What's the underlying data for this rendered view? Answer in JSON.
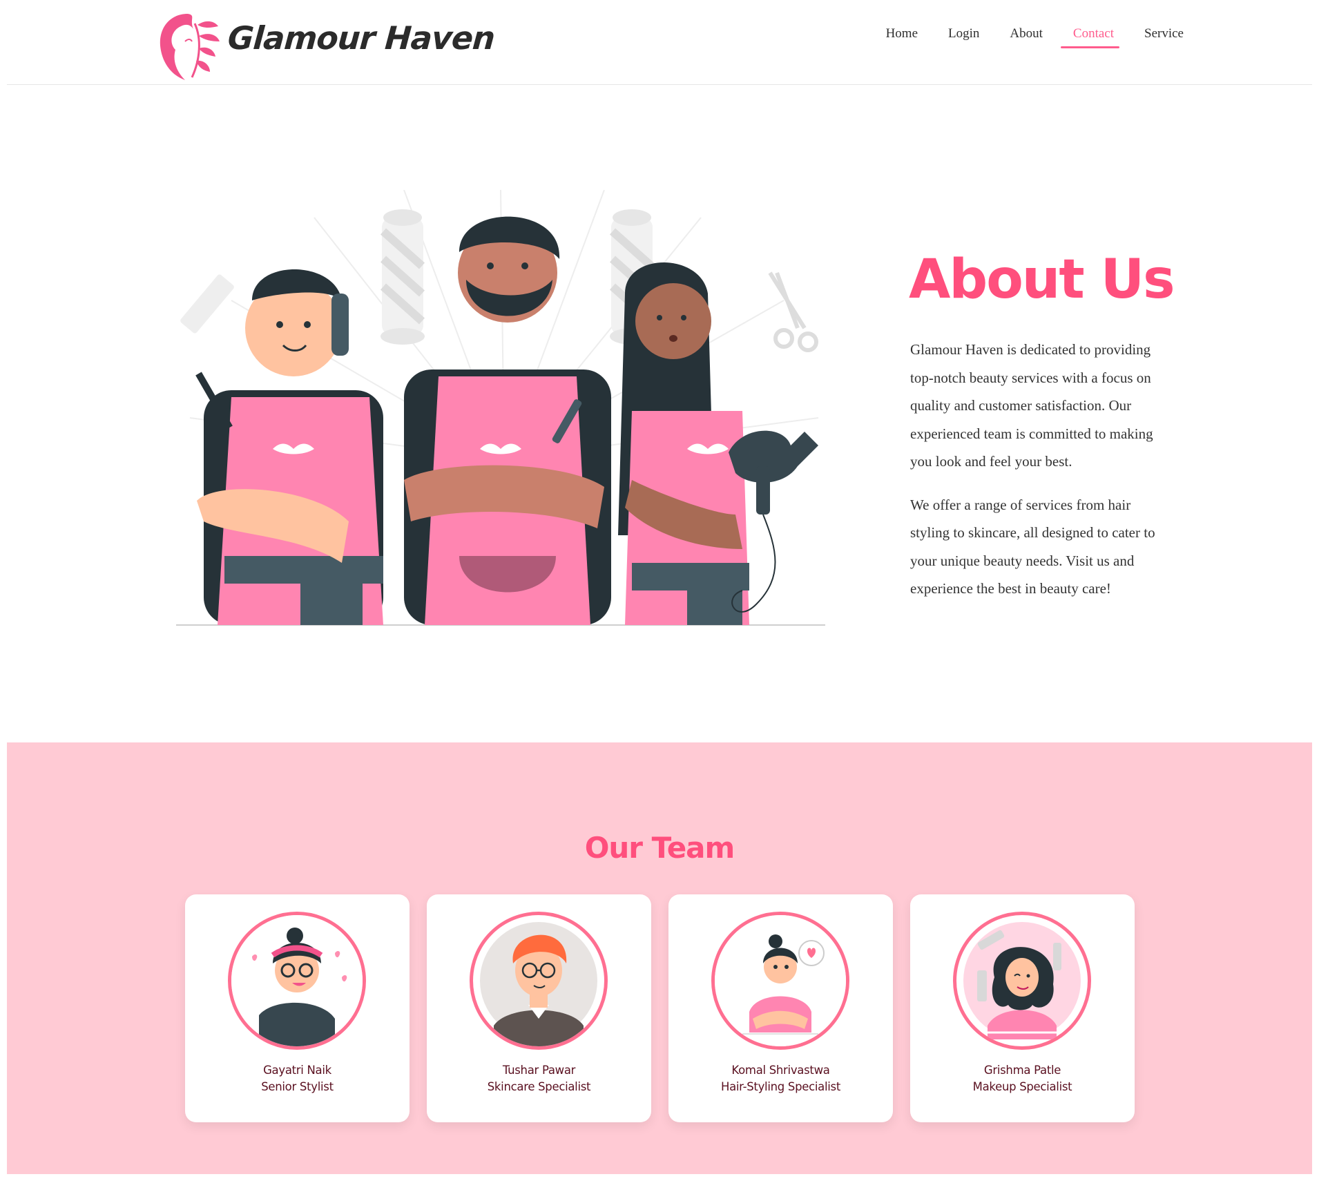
{
  "brand": {
    "name": "Glamour Haven"
  },
  "nav": {
    "items": [
      {
        "label": "Home",
        "active": false
      },
      {
        "label": "Login",
        "active": false
      },
      {
        "label": "About",
        "active": false
      },
      {
        "label": "Contact",
        "active": true
      },
      {
        "label": "Service",
        "active": false
      }
    ]
  },
  "about": {
    "title": "About Us",
    "paragraphs": [
      "Glamour Haven is dedicated to providing top-notch beauty services with a focus on quality and customer satisfaction. Our experienced team is committed to making you look and feel your best.",
      "We offer a range of services from hair styling to skincare, all designed to cater to your unique beauty needs. Visit us and experience the best in beauty care!"
    ]
  },
  "team": {
    "title": "Our Team",
    "members": [
      {
        "name": "Gayatri Naik",
        "role": "Senior Stylist"
      },
      {
        "name": "Tushar Pawar",
        "role": "Skincare Specialist"
      },
      {
        "name": "Komal Shrivastwa",
        "role": "Hair-Styling Specialist"
      },
      {
        "name": "Grishma Patle",
        "role": "Makeup Specialist"
      }
    ]
  },
  "colors": {
    "accent": "#ff4f7d",
    "nav_active": "#ff5c8d",
    "team_bg": "#ffcad4",
    "avatar_ring": "#ff6f91",
    "apron_pink": "#ff85b1",
    "dark_text": "#5a1020"
  },
  "icons": {
    "logo": "woman-profile-with-leaves-logo",
    "hero": "three-hairstylists-illustration"
  }
}
